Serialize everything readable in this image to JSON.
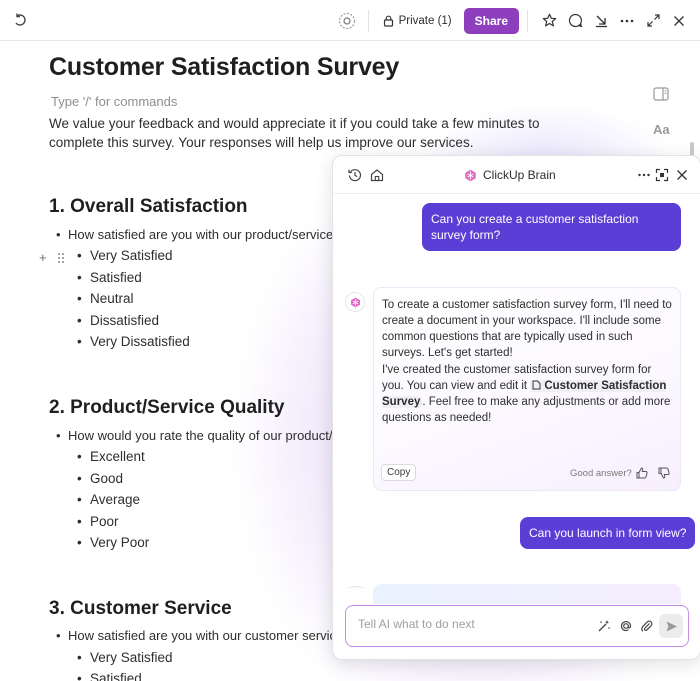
{
  "toolbar": {
    "private_label": "Private (1)",
    "share_label": "Share"
  },
  "doc": {
    "title": "Customer Satisfaction Survey",
    "command_hint": "Type '/' for commands",
    "intro": "We value your feedback and would appreciate it if you could take a few minutes to complete this survey. Your responses will help us improve our services.",
    "font_toggle_label": "Aa",
    "sections": [
      {
        "heading": "1. Overall Satisfaction",
        "question": "How satisfied are you with our product/service?",
        "options": [
          "Very Satisfied",
          "Satisfied",
          "Neutral",
          "Dissatisfied",
          "Very Dissatisfied"
        ]
      },
      {
        "heading": "2. Product/Service Quality",
        "question": "How would you rate the quality of our product/service?",
        "options": [
          "Excellent",
          "Good",
          "Average",
          "Poor",
          "Very Poor"
        ]
      },
      {
        "heading": "3. Customer Service",
        "question": "How satisfied are you with our customer service?",
        "options": [
          "Very Satisfied",
          "Satisfied"
        ]
      }
    ]
  },
  "ai_panel": {
    "title": "ClickUp Brain",
    "messages": {
      "user_1": "Can you create a customer satisfaction survey form?",
      "ai_p1": "To create a customer satisfaction survey form, I'll need to create a document in your workspace. I'll include some common questions that are typically used in such surveys. Let's get started!",
      "ai_p2_before": "I've created the customer satisfaction survey form for you. You can view and edit it ",
      "ai_doc_link": "Customer Satisfaction Survey",
      "ai_p2_after": ". Feel free to make any adjustments or add more questions as needed!",
      "copy_label": "Copy",
      "feedback_prompt": "Good answer?",
      "user_2": "Can you launch in form view?"
    },
    "input_placeholder": "Tell AI what to do next"
  },
  "colors": {
    "share": "#8e3fbd",
    "user_bubble": "#5b3ed6",
    "fab": "#e0408e",
    "input_border": "#c78de6"
  }
}
